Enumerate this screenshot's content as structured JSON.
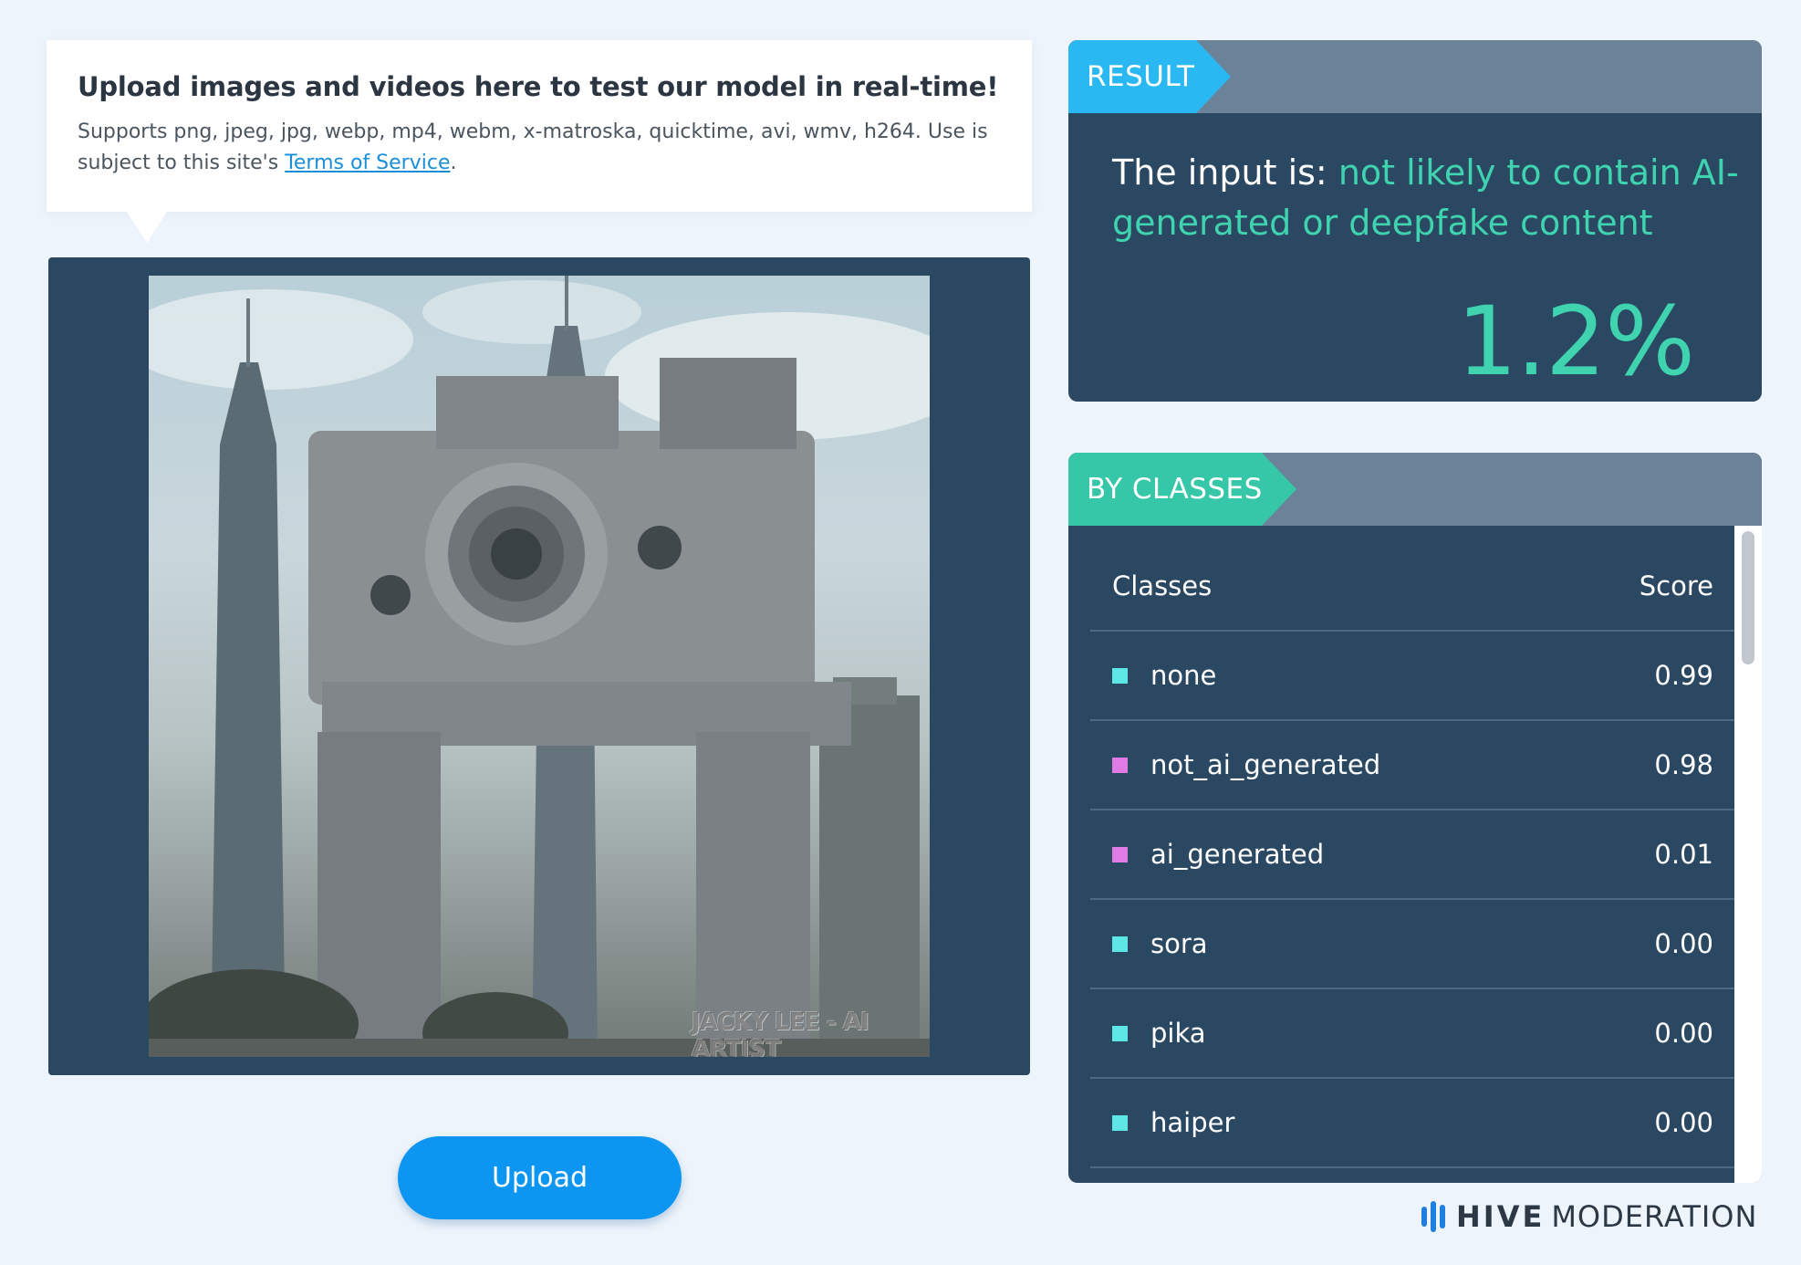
{
  "info": {
    "title": "Upload images and videos here to test our model in real-time!",
    "description": "Supports png, jpeg, jpg, webp, mp4, webm, x-matroska, quicktime, avi, wmv, h264. Use is subject to this site's ",
    "tos_link": "Terms of Service",
    "tos_suffix": "."
  },
  "preview": {
    "watermark": "JACKY LEE - AI ARTIST"
  },
  "upload": {
    "label": "Upload"
  },
  "result": {
    "tag": "RESULT",
    "prefix": "The input is: ",
    "verdict": "not likely to contain AI-generated or deepfake content",
    "percent": "1.2%"
  },
  "classes": {
    "tag": "BY CLASSES",
    "header_class": "Classes",
    "header_score": "Score",
    "rows": [
      {
        "name": "none",
        "score": "0.99",
        "color": "#5ee6e6"
      },
      {
        "name": "not_ai_generated",
        "score": "0.98",
        "color": "#e07be6"
      },
      {
        "name": "ai_generated",
        "score": "0.01",
        "color": "#e07be6"
      },
      {
        "name": "sora",
        "score": "0.00",
        "color": "#5ee6e6"
      },
      {
        "name": "pika",
        "score": "0.00",
        "color": "#5ee6e6"
      },
      {
        "name": "haiper",
        "score": "0.00",
        "color": "#5ee6e6"
      }
    ]
  },
  "logo": {
    "bold": "HIVE",
    "light": "MODERATION"
  },
  "colors": {
    "panel": "#2b4862",
    "accent_blue": "#29b8f2",
    "accent_green": "#3fd3b0",
    "button": "#0c96f2"
  }
}
